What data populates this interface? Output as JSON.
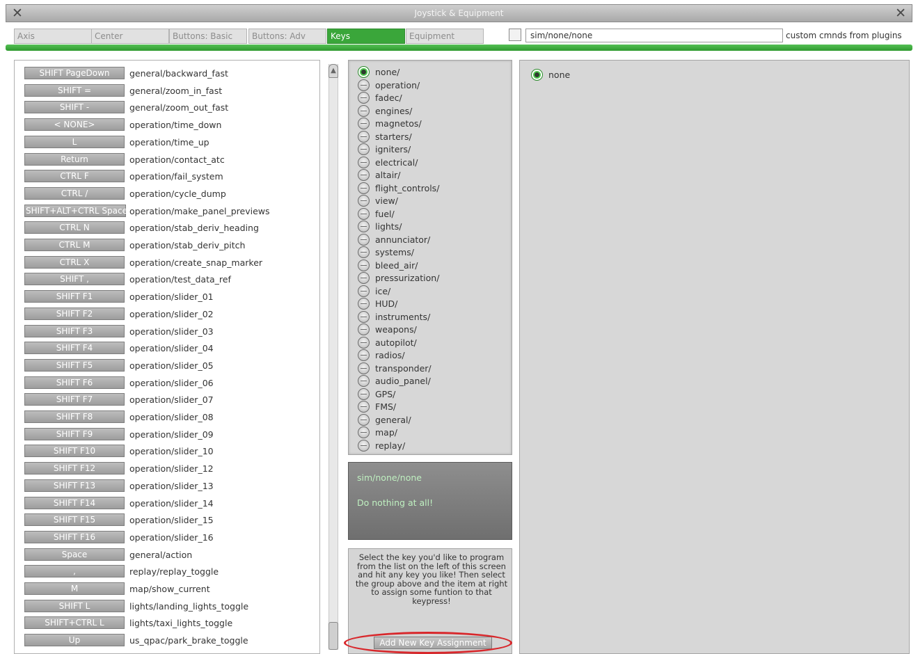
{
  "window": {
    "title": "Joystick & Equipment",
    "close_left": "✕",
    "close_right": "✕"
  },
  "tabs": [
    {
      "label": "Axis",
      "active": false
    },
    {
      "label": "Center",
      "active": false
    },
    {
      "label": "Buttons: Basic",
      "active": false
    },
    {
      "label": "Buttons: Adv",
      "active": false
    },
    {
      "label": "Keys",
      "active": true
    },
    {
      "label": "Equipment",
      "active": false
    }
  ],
  "filter": {
    "value": "sim/none/none",
    "plugin_label": "custom cmnds from plugins"
  },
  "keys": [
    {
      "key": "SHIFT PageDown",
      "command": "general/backward_fast"
    },
    {
      "key": "SHIFT =",
      "command": "general/zoom_in_fast"
    },
    {
      "key": "SHIFT -",
      "command": "general/zoom_out_fast"
    },
    {
      "key": "< NONE>",
      "command": "operation/time_down"
    },
    {
      "key": "L",
      "command": "operation/time_up"
    },
    {
      "key": "Return",
      "command": "operation/contact_atc"
    },
    {
      "key": "CTRL F",
      "command": "operation/fail_system"
    },
    {
      "key": "CTRL /",
      "command": "operation/cycle_dump"
    },
    {
      "key": "SHIFT+ALT+CTRL Space",
      "command": "operation/make_panel_previews"
    },
    {
      "key": "CTRL N",
      "command": "operation/stab_deriv_heading"
    },
    {
      "key": "CTRL M",
      "command": "operation/stab_deriv_pitch"
    },
    {
      "key": "CTRL X",
      "command": "operation/create_snap_marker"
    },
    {
      "key": "SHIFT ,",
      "command": "operation/test_data_ref"
    },
    {
      "key": "SHIFT F1",
      "command": "operation/slider_01"
    },
    {
      "key": "SHIFT F2",
      "command": "operation/slider_02"
    },
    {
      "key": "SHIFT F3",
      "command": "operation/slider_03"
    },
    {
      "key": "SHIFT F4",
      "command": "operation/slider_04"
    },
    {
      "key": "SHIFT F5",
      "command": "operation/slider_05"
    },
    {
      "key": "SHIFT F6",
      "command": "operation/slider_06"
    },
    {
      "key": "SHIFT F7",
      "command": "operation/slider_07"
    },
    {
      "key": "SHIFT F8",
      "command": "operation/slider_08"
    },
    {
      "key": "SHIFT F9",
      "command": "operation/slider_09"
    },
    {
      "key": "SHIFT F10",
      "command": "operation/slider_10"
    },
    {
      "key": "SHIFT F12",
      "command": "operation/slider_12"
    },
    {
      "key": "SHIFT F13",
      "command": "operation/slider_13"
    },
    {
      "key": "SHIFT F14",
      "command": "operation/slider_14"
    },
    {
      "key": "SHIFT F15",
      "command": "operation/slider_15"
    },
    {
      "key": "SHIFT F16",
      "command": "operation/slider_16"
    },
    {
      "key": "Space",
      "command": "general/action"
    },
    {
      "key": ",",
      "command": "replay/replay_toggle"
    },
    {
      "key": "M",
      "command": "map/show_current"
    },
    {
      "key": "SHIFT L",
      "command": "lights/landing_lights_toggle"
    },
    {
      "key": "SHIFT+CTRL L",
      "command": "lights/taxi_lights_toggle"
    },
    {
      "key": "Up",
      "command": "us_qpac/park_brake_toggle"
    }
  ],
  "groups": [
    {
      "label": "none/",
      "selected": true
    },
    {
      "label": "operation/",
      "selected": false
    },
    {
      "label": "fadec/",
      "selected": false
    },
    {
      "label": "engines/",
      "selected": false
    },
    {
      "label": "magnetos/",
      "selected": false
    },
    {
      "label": "starters/",
      "selected": false
    },
    {
      "label": "igniters/",
      "selected": false
    },
    {
      "label": "electrical/",
      "selected": false
    },
    {
      "label": "altair/",
      "selected": false
    },
    {
      "label": "flight_controls/",
      "selected": false
    },
    {
      "label": "view/",
      "selected": false
    },
    {
      "label": "fuel/",
      "selected": false
    },
    {
      "label": "lights/",
      "selected": false
    },
    {
      "label": "annunciator/",
      "selected": false
    },
    {
      "label": "systems/",
      "selected": false
    },
    {
      "label": "bleed_air/",
      "selected": false
    },
    {
      "label": "pressurization/",
      "selected": false
    },
    {
      "label": "ice/",
      "selected": false
    },
    {
      "label": "HUD/",
      "selected": false
    },
    {
      "label": "instruments/",
      "selected": false
    },
    {
      "label": "weapons/",
      "selected": false
    },
    {
      "label": "autopilot/",
      "selected": false
    },
    {
      "label": "radios/",
      "selected": false
    },
    {
      "label": "transponder/",
      "selected": false
    },
    {
      "label": "audio_panel/",
      "selected": false
    },
    {
      "label": "GPS/",
      "selected": false
    },
    {
      "label": "FMS/",
      "selected": false
    },
    {
      "label": "general/",
      "selected": false
    },
    {
      "label": "map/",
      "selected": false
    },
    {
      "label": "replay/",
      "selected": false
    }
  ],
  "info": {
    "command": "sim/none/none",
    "description": "Do nothing at all!"
  },
  "help": {
    "text": "Select the key you'd like to program from the list on the left of this screen and hit any key you like! Then select the group above and the item at right to assign some funtion to that keypress!",
    "add_button": "Add New Key Assignment"
  },
  "commands": [
    {
      "label": "none",
      "selected": true
    }
  ],
  "colors": {
    "active_tab": "#3aa63a",
    "highlight_ring": "#d8272b",
    "info_text": "#bff0c0"
  }
}
